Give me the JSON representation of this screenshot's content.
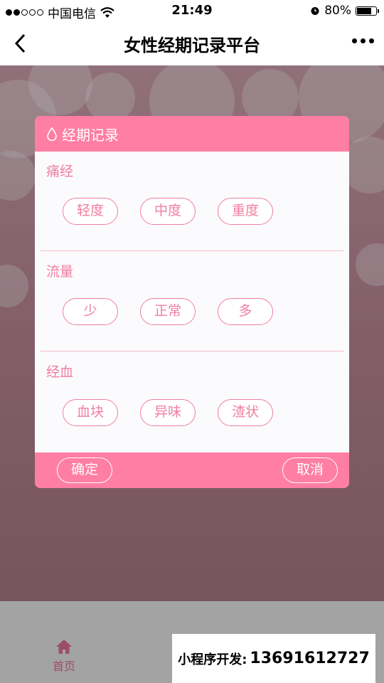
{
  "status_bar": {
    "carrier": "中国电信",
    "time": "21:49",
    "battery": "80%",
    "battery_level": 0.8
  },
  "nav": {
    "title": "女性经期记录平台"
  },
  "dialog": {
    "title": "经期记录",
    "sections": [
      {
        "label": "痛经",
        "options": [
          "轻度",
          "中度",
          "重度"
        ]
      },
      {
        "label": "流量",
        "options": [
          "少",
          "正常",
          "多"
        ]
      },
      {
        "label": "经血",
        "options": [
          "血块",
          "异味",
          "渣状"
        ]
      }
    ],
    "confirm": "确定",
    "cancel": "取消"
  },
  "tab_bar": {
    "home_label": "首页"
  },
  "promo": {
    "label": "小程序开发:",
    "phone": "13691612727"
  },
  "colors": {
    "accent": "#ff7ea3",
    "text_pink": "#f07ea0"
  }
}
